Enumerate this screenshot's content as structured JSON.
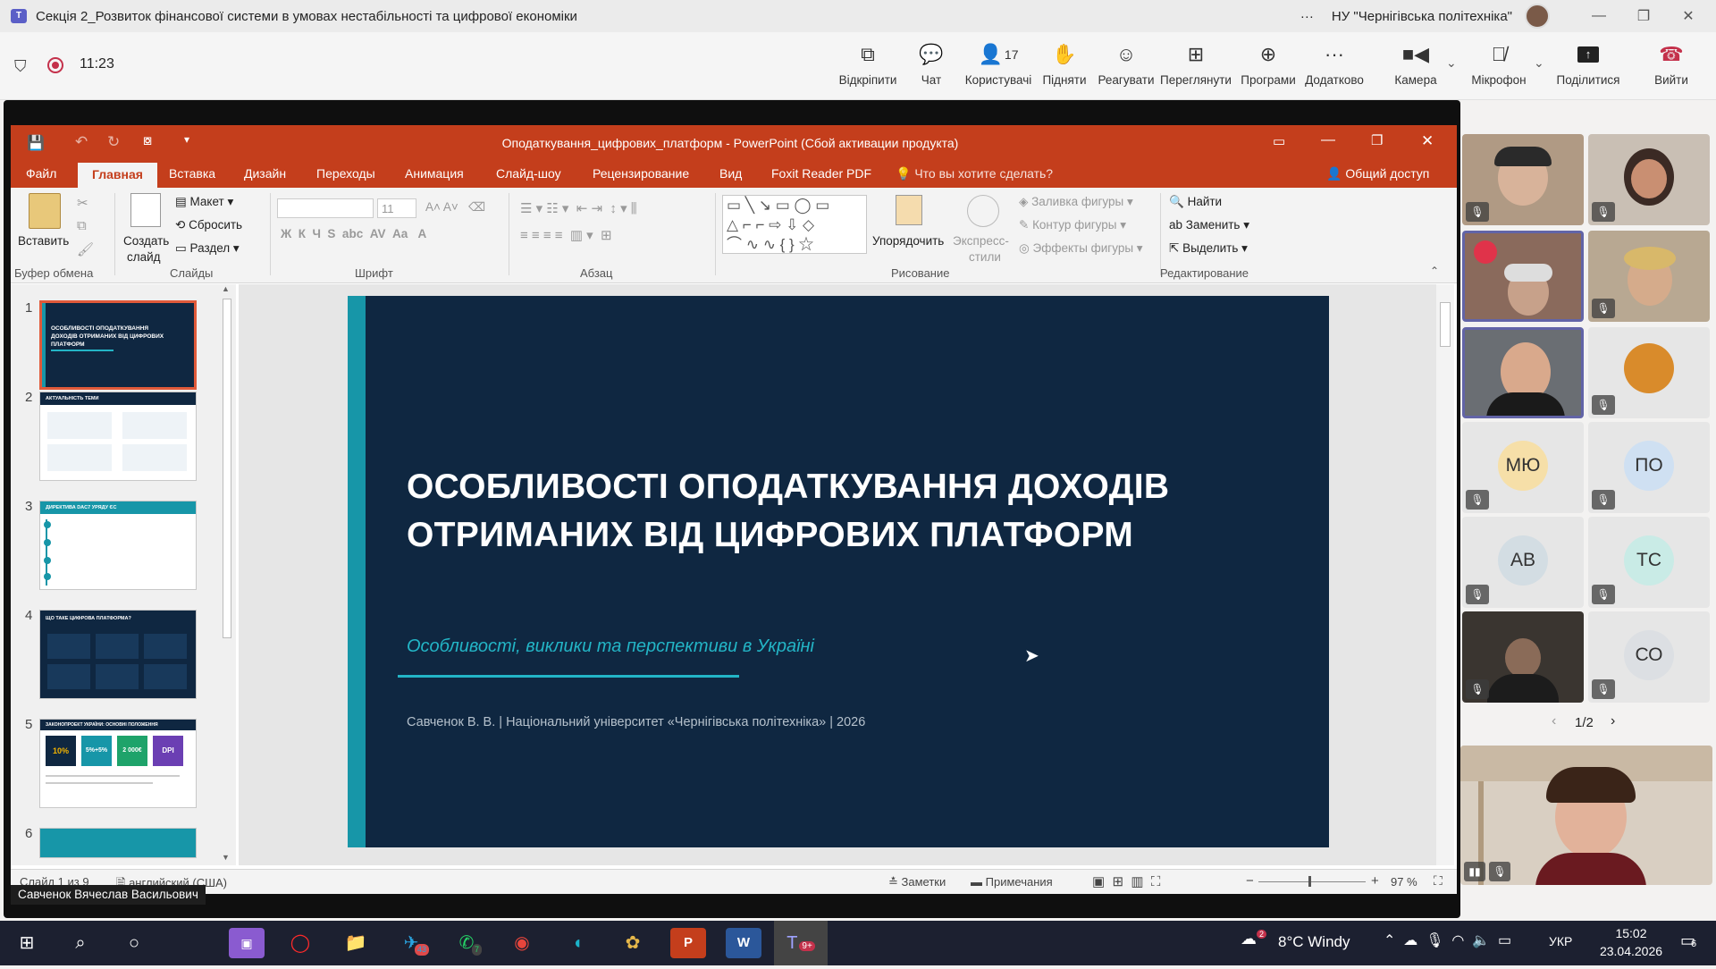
{
  "window": {
    "title": "Секція 2_Розвиток фінансової системи в умовах нестабільності та цифрової економіки",
    "org": "НУ \"Чернігівська політехніка\"",
    "more": "···"
  },
  "meeting": {
    "time": "11:23",
    "controls": {
      "popout": "Відкріпити",
      "chat": "Чат",
      "people": "Користувачі",
      "people_count": "17",
      "raise": "Підняти",
      "react": "Реагувати",
      "view": "Переглянути",
      "apps": "Програми",
      "more": "Додатково",
      "camera": "Камера",
      "mic": "Мікрофон",
      "share": "Поділитися",
      "leave": "Вийти"
    }
  },
  "ppt": {
    "title": "Оподаткування_цифрових_платформ - PowerPoint (Сбой активации продукта)",
    "menu": [
      "Файл",
      "Главная",
      "Вставка",
      "Дизайн",
      "Переходы",
      "Анимация",
      "Слайд-шоу",
      "Рецензирование",
      "Вид",
      "Foxit Reader PDF"
    ],
    "tell_me": "Что вы хотите сделать?",
    "share": "Общий доступ",
    "ribbon": {
      "paste": "Вставить",
      "new_slide_1": "Создать",
      "new_slide_2": "слайд",
      "layout": "Макет",
      "reset": "Сбросить",
      "section": "Раздел",
      "font_size": "11",
      "arrange": "Упорядочить",
      "quick_styles_1": "Экспресс-",
      "quick_styles_2": "стили",
      "shape_fill": "Заливка фигуры",
      "shape_outline": "Контур фигуры",
      "shape_effects": "Эффекты фигуры",
      "find": "Найти",
      "replace": "Заменить",
      "select": "Выделить",
      "groups": [
        "Буфер обмена",
        "Слайды",
        "Шрифт",
        "Абзац",
        "Рисование",
        "Редактирование"
      ]
    },
    "thumbs": [
      {
        "num": "1",
        "caption": "ОСОБЛИВОСТІ ОПОДАТКУВАННЯ ДОХОДІВ ОТРИМАНИХ ВІД ЦИФРОВИХ ПЛАТФОРМ"
      },
      {
        "num": "2",
        "caption": "АКТУАЛЬНІСТЬ ТЕМИ"
      },
      {
        "num": "3",
        "caption": "ДИРЕКТИВА DAC7 УРЯДУ ЄС"
      },
      {
        "num": "4",
        "caption": "ЩО ТАКЕ ЦИФРОВА ПЛАТФОРМА?"
      },
      {
        "num": "5",
        "caption": "ЗАКОНОПРОЕКТ УКРАЇНИ: ОСНОВНІ ПОЛОЖЕННЯ"
      },
      {
        "num": "6",
        "caption": ""
      }
    ],
    "thumb5_boxes": [
      "10%",
      "5%+5%",
      "2 000€",
      "DPI"
    ],
    "slide": {
      "title_line1": "ОСОБЛИВОСТІ ОПОДАТКУВАННЯ ДОХОДІВ",
      "title_line2": "ОТРИМАНИХ ВІД ЦИФРОВИХ ПЛАТФОРМ",
      "subtitle": "Особливості, виклики та перспективи в Україні",
      "footer": "Савченок В. В.  |  Національний університет «Чернігівська політехніка»  |  2026"
    },
    "status": {
      "slide_info": "Слайд 1 из 9",
      "language": "английский (США)",
      "notes": "Заметки",
      "comments": "Примечания",
      "zoom": "97 %"
    }
  },
  "presenter_name": "Савченок Вячеслав Васильович",
  "participants": [
    {
      "initials": "МЮ"
    },
    {
      "initials": "ПО"
    },
    {
      "initials": "АВ"
    },
    {
      "initials": "ТС"
    },
    {
      "initials": "СО"
    }
  ],
  "pagination": "1/2",
  "taskbar": {
    "weather": "8°C  Windy",
    "weather_badge": "2",
    "lang": "УКР",
    "time": "15:02",
    "date": "23.04.2026",
    "notif": "6",
    "telegram_badge": "43",
    "whatsapp_badge": "7",
    "teams_badge": "9+"
  }
}
